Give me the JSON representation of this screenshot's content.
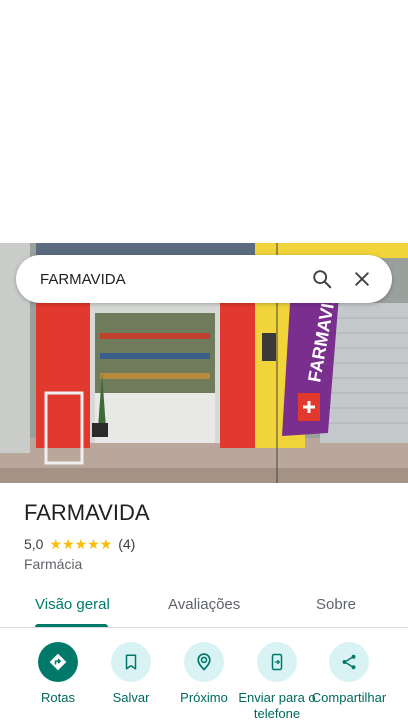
{
  "search": {
    "query": "FARMAVIDA"
  },
  "photo": {
    "sign_text": "FARMAVIDA",
    "alt": "FARMAVIDA"
  },
  "place": {
    "name": "FARMAVIDA",
    "rating": "5,0",
    "stars": "★★★★★",
    "review_count": "(4)",
    "category": "Farmácia"
  },
  "tabs": [
    {
      "label": "Visão geral",
      "active": true
    },
    {
      "label": "Avaliações",
      "active": false
    },
    {
      "label": "Sobre",
      "active": false
    }
  ],
  "actions": [
    {
      "label": "Rotas",
      "icon": "directions-icon"
    },
    {
      "label": "Salvar",
      "icon": "bookmark-icon"
    },
    {
      "label": "Próximo",
      "icon": "nearby-icon"
    },
    {
      "label": "Enviar para o telefone",
      "icon": "send-to-phone-icon"
    },
    {
      "label": "Compartilhar",
      "icon": "share-icon"
    }
  ],
  "colors": {
    "accent": "#00796b",
    "action_bg": "#d9f3f5",
    "star": "#fbbc04"
  }
}
